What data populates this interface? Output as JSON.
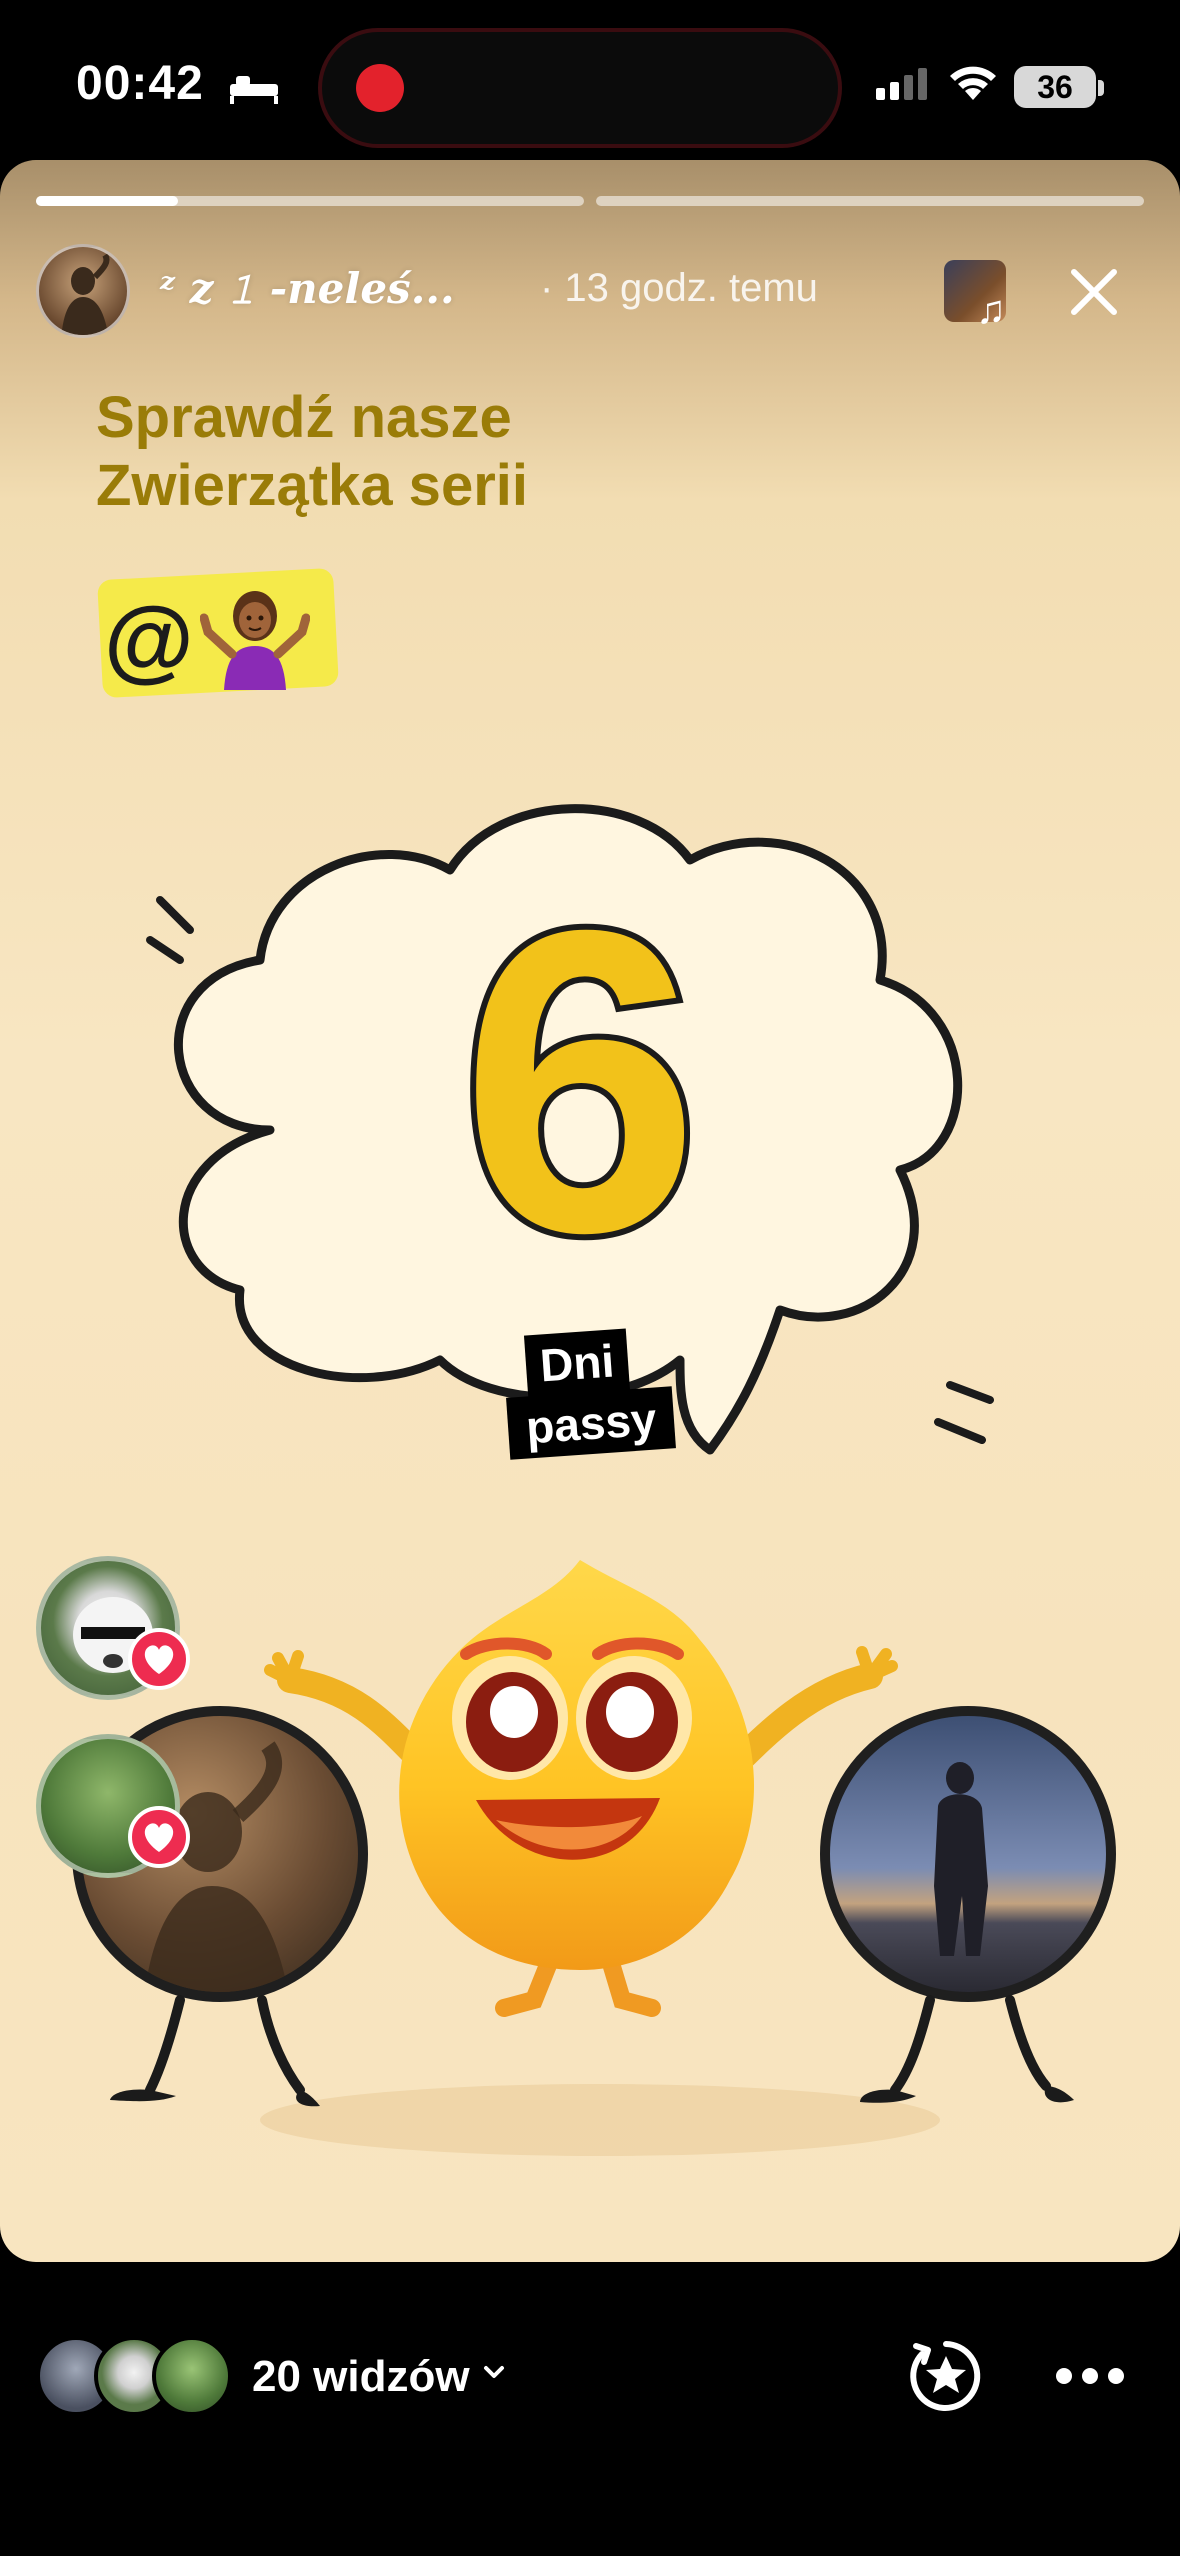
{
  "status_bar": {
    "time": "00:42",
    "battery": "36"
  },
  "story": {
    "user": {
      "name": "ᶻ z 𝟷 -𝒏𝒆𝒍𝒆ś...",
      "posted": "· 13 godz. temu"
    },
    "progress": [
      0.26,
      0.0
    ],
    "headline_line1": "Sprawdź nasze",
    "headline_line2": "Zwierzątka serii",
    "mention": "@",
    "mention_emoji": "🤷🏾‍♀️",
    "streak_number": "6",
    "streak_label_line1": "Dni",
    "streak_label_line2": "passy",
    "likes": [
      {
        "icon": "heart-icon"
      },
      {
        "icon": "heart-icon"
      }
    ]
  },
  "footer": {
    "viewers_label": "20 widzów",
    "highlight_icon": "star-highlight-icon",
    "more_icon": "more-dots-icon"
  },
  "colors": {
    "background": "#000000",
    "story_bg": "#f8e6c2",
    "headline": "#9a7c08",
    "streak_yellow": "#f2c21a",
    "heart": "#ee2c50",
    "record": "#e3222c"
  }
}
